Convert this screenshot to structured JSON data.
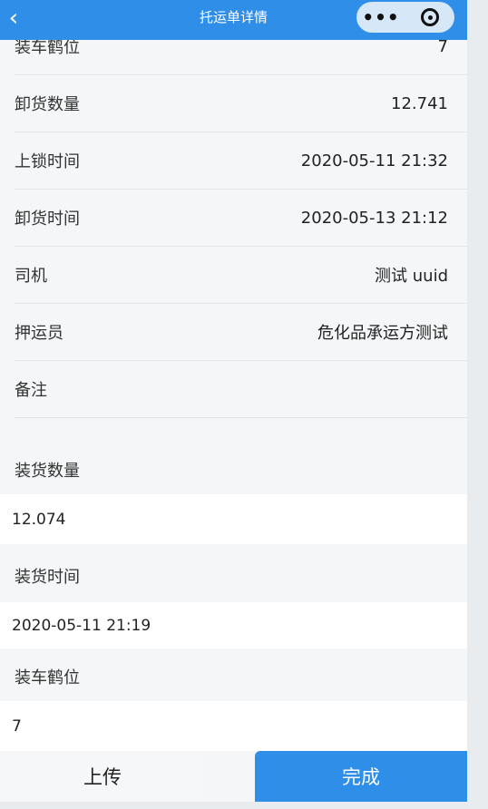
{
  "nav": {
    "title": "托运单详情",
    "back_icon": "‹",
    "more_icon": "•••"
  },
  "rows": [
    {
      "label": "装车鹤位",
      "value": "7"
    },
    {
      "label": "卸货数量",
      "value": "12.741"
    },
    {
      "label": "上锁时间",
      "value": "2020-05-11 21:32"
    },
    {
      "label": "卸货时间",
      "value": "2020-05-13 21:12"
    },
    {
      "label": "司机",
      "value": "测试 uuid"
    },
    {
      "label": "押运员",
      "value": "危化品承运方测试"
    },
    {
      "label": "备注",
      "value": ""
    }
  ],
  "sections": [
    {
      "label": "装货数量",
      "value": "12.074"
    },
    {
      "label": "装货时间",
      "value": "2020-05-11 21:19"
    },
    {
      "label": "装车鹤位",
      "value": "7"
    }
  ],
  "actions": {
    "upload": "上传",
    "done": "完成"
  },
  "colors": {
    "accent": "#2f8fe8",
    "background": "#f4f6f7"
  }
}
